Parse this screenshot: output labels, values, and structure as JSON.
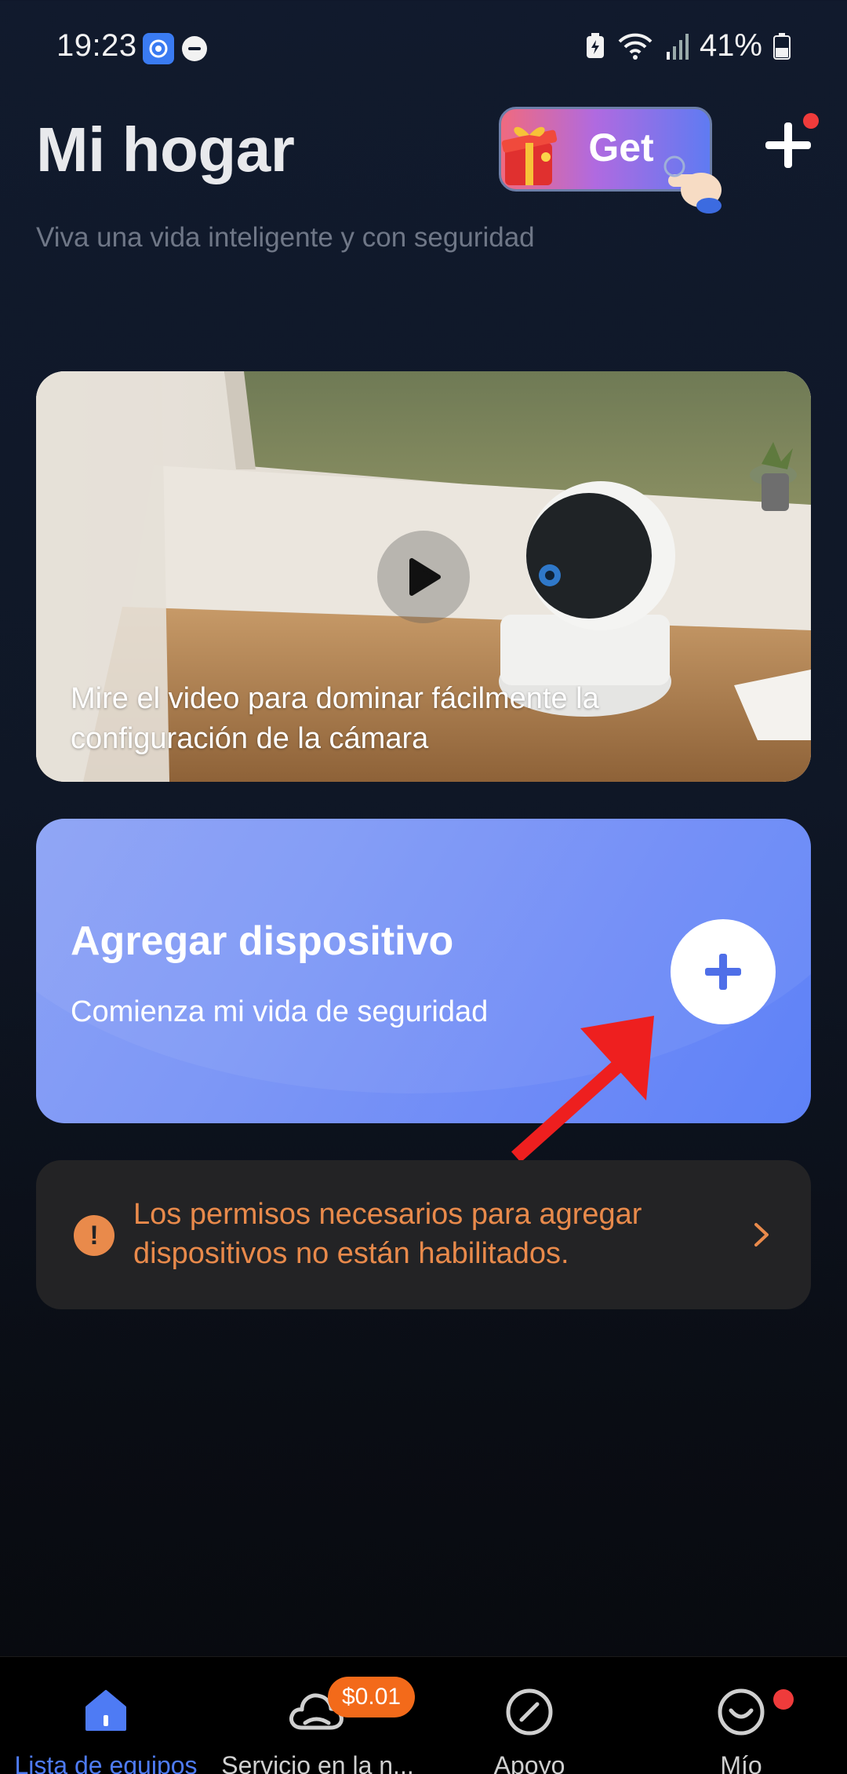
{
  "status_bar": {
    "time": "19:23",
    "battery": "41%",
    "icons": [
      "app-notification-icon",
      "do-not-disturb-icon",
      "battery-saver-icon",
      "wifi-icon",
      "signal-icon",
      "battery-icon"
    ]
  },
  "header": {
    "title": "Mi hogar",
    "subtitle": "Viva una vida inteligente y con seguridad",
    "promo_label": "Get"
  },
  "video_card": {
    "caption": "Mire el video para dominar fácilmente la configuración de la cámara"
  },
  "add_device_card": {
    "title": "Agregar dispositivo",
    "subtitle": "Comienza mi vida de seguridad"
  },
  "permission_notice": {
    "text": "Los permisos necesarios para agregar dispositivos no están habilitados.",
    "icon": "!"
  },
  "bottom_nav": {
    "items": [
      {
        "label": "Lista de equipos",
        "icon": "home-icon",
        "active": true
      },
      {
        "label": "Servicio en la n...",
        "icon": "cloud-icon",
        "badge": "$0.01"
      },
      {
        "label": "Apoyo",
        "icon": "compass-icon"
      },
      {
        "label": "Mío",
        "icon": "profile-smile-icon"
      }
    ]
  },
  "colors": {
    "accent": "#4e7bf4",
    "warning": "#e98a4b",
    "badge": "#f36a1a",
    "notification_dot": "#ef3b3b"
  }
}
